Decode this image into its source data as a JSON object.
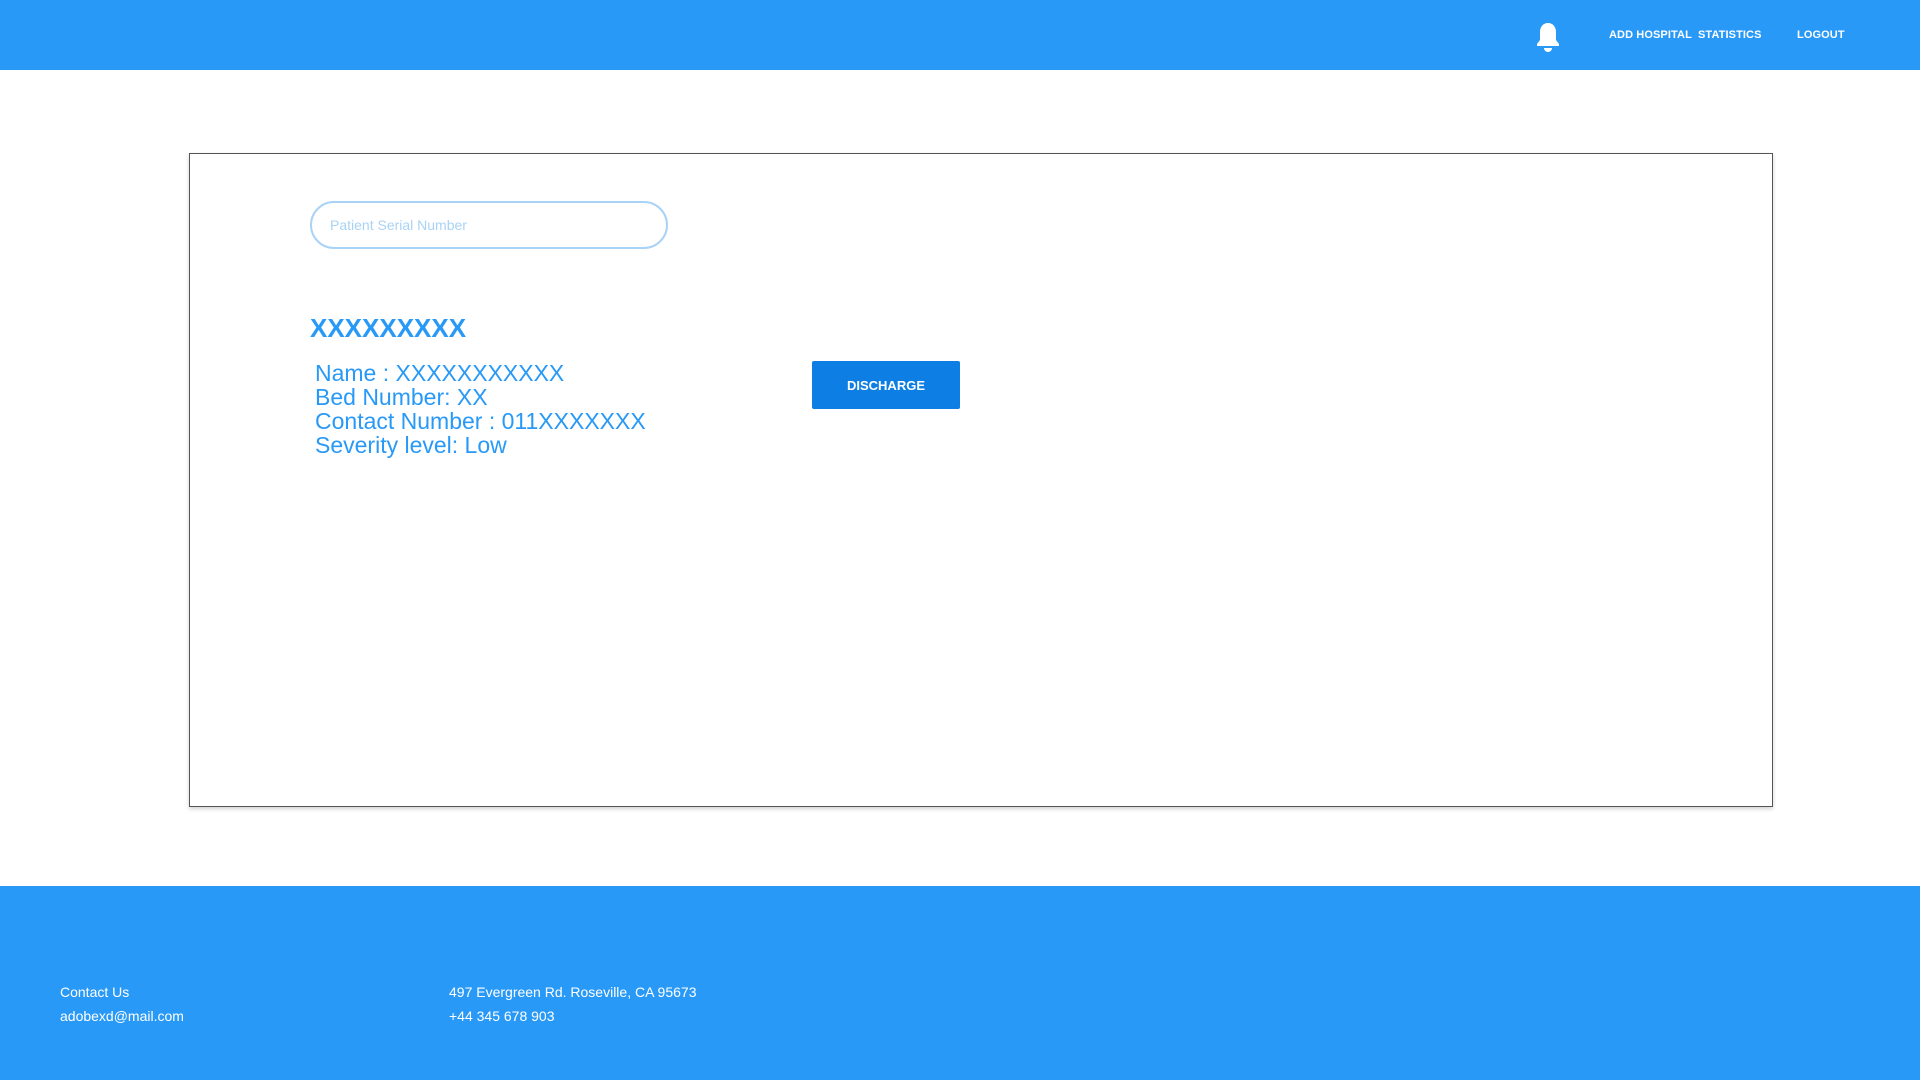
{
  "header": {
    "bell_icon": "bell-icon",
    "nav": {
      "add_hospital": "ADD HOSPITAL",
      "statistics": "STATISTICS",
      "logout": "LOGOUT"
    }
  },
  "search": {
    "placeholder": "Patient Serial Number",
    "value": ""
  },
  "patient": {
    "serial": "XXXXXXXXX",
    "name": "Name : XXXXXXXXXXX",
    "bed": "Bed Number: XX",
    "contact": "Contact Number : 011XXXXXXX",
    "severity": "Severity level: Low"
  },
  "actions": {
    "discharge_label": "DISCHARGE"
  },
  "footer": {
    "contact_title": "Contact Us",
    "email": "adobexd@mail.com",
    "address": "497 Evergreen Rd. Roseville, CA 95673",
    "phone": "+44 345 678 903"
  },
  "colors": {
    "primary": "#2899f7",
    "button": "#0d7fe4",
    "input_border": "#a9d3f6",
    "card_border": "#555555"
  }
}
